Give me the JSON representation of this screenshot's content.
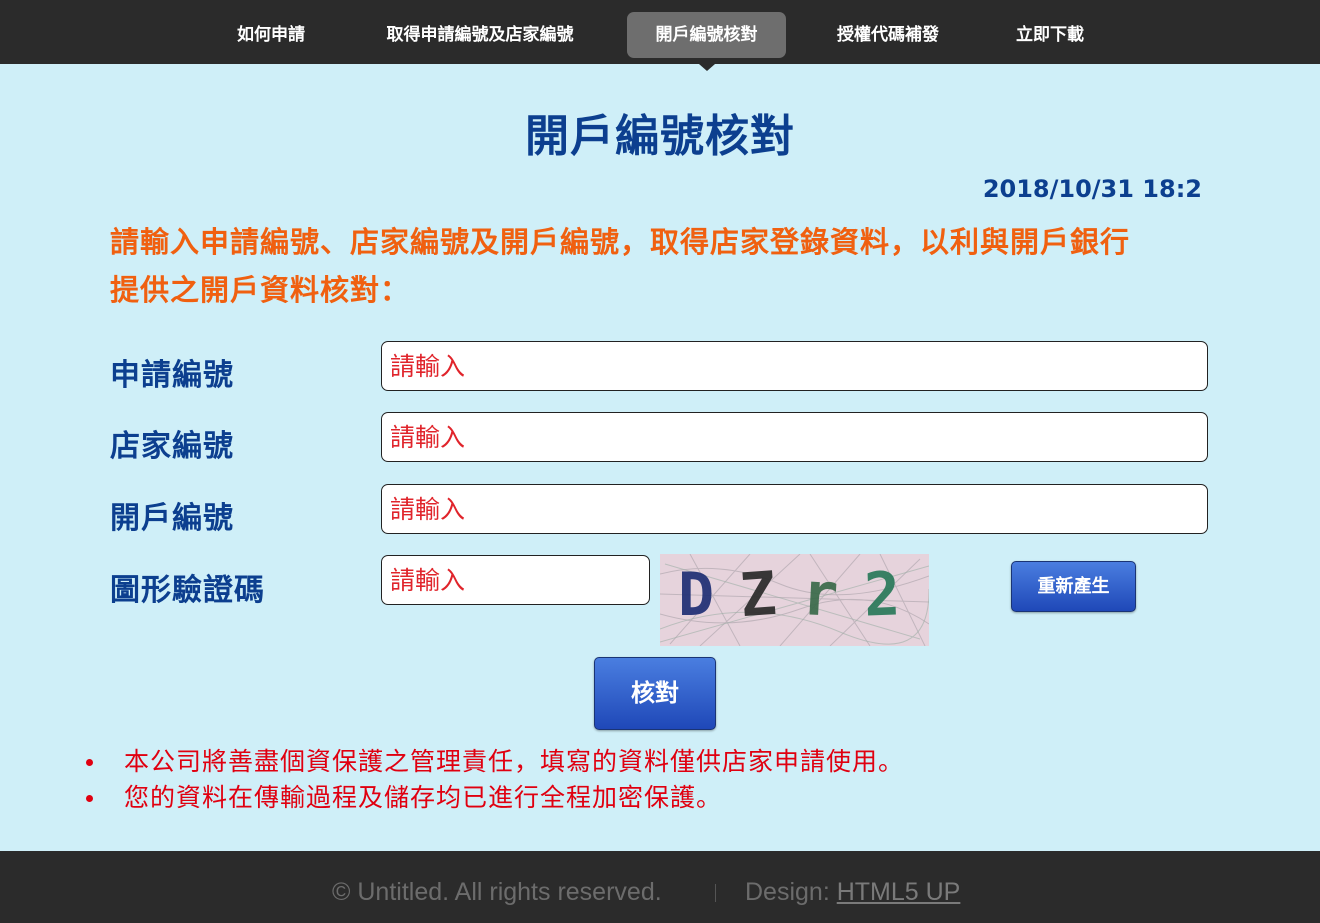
{
  "nav": {
    "items": [
      {
        "label": "如何申請"
      },
      {
        "label": "取得申請編號及店家編號"
      },
      {
        "label": "開戶編號核對"
      },
      {
        "label": "授權代碼補發"
      },
      {
        "label": "立即下載"
      }
    ],
    "active_index": 2
  },
  "main": {
    "title": "開戶編號核對",
    "timestamp": "2018/10/31 18:2",
    "instruction_line1": "請輸入申請編號、店家編號及開戶編號，取得店家登錄資料，以利與開戶銀行",
    "instruction_line2": "提供之開戶資料核對："
  },
  "form": {
    "fields": [
      {
        "label": "申請編號",
        "placeholder": "請輸入",
        "value": ""
      },
      {
        "label": "店家編號",
        "placeholder": "請輸入",
        "value": ""
      },
      {
        "label": "開戶編號",
        "placeholder": "請輸入",
        "value": ""
      },
      {
        "label": "圖形驗證碼",
        "placeholder": "請輸入",
        "value": ""
      }
    ],
    "captcha_text": "DZr2",
    "captcha_chars": [
      {
        "ch": "D",
        "color": "#1f2f74"
      },
      {
        "ch": "Z",
        "color": "#2a2a2a"
      },
      {
        "ch": "r",
        "color": "#3a6a4a"
      },
      {
        "ch": "2",
        "color": "#2a7a5a"
      }
    ],
    "refresh_label": "重新產生",
    "submit_label": "核對"
  },
  "notes": [
    "本公司將善盡個資保護之管理責任，填寫的資料僅供店家申請使用。",
    "您的資料在傳輸過程及儲存均已進行全程加密保護。"
  ],
  "colors": {
    "background": "#cfeff8",
    "nav_bg": "#2b2b2b",
    "title_blue": "#0c3f8f",
    "instruction_orange": "#f06010",
    "note_red": "#e00010",
    "button_blue": "#2a55c5"
  },
  "footer": {
    "copyright": "© Untitled. All rights reserved.",
    "design_label": "Design:",
    "design_link": "HTML5 UP"
  }
}
